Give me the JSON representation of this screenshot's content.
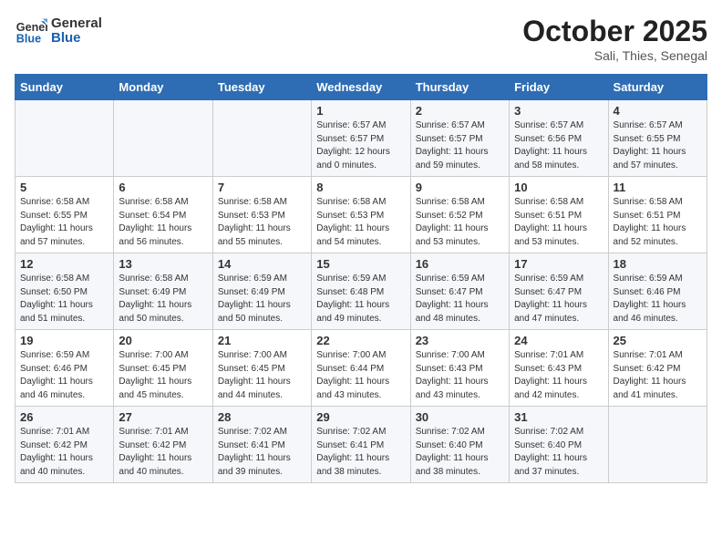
{
  "header": {
    "logo_general": "General",
    "logo_blue": "Blue",
    "month": "October 2025",
    "location": "Sali, Thies, Senegal"
  },
  "days_of_week": [
    "Sunday",
    "Monday",
    "Tuesday",
    "Wednesday",
    "Thursday",
    "Friday",
    "Saturday"
  ],
  "weeks": [
    [
      {
        "day": "",
        "info": ""
      },
      {
        "day": "",
        "info": ""
      },
      {
        "day": "",
        "info": ""
      },
      {
        "day": "1",
        "info": "Sunrise: 6:57 AM\nSunset: 6:57 PM\nDaylight: 12 hours\nand 0 minutes."
      },
      {
        "day": "2",
        "info": "Sunrise: 6:57 AM\nSunset: 6:57 PM\nDaylight: 11 hours\nand 59 minutes."
      },
      {
        "day": "3",
        "info": "Sunrise: 6:57 AM\nSunset: 6:56 PM\nDaylight: 11 hours\nand 58 minutes."
      },
      {
        "day": "4",
        "info": "Sunrise: 6:57 AM\nSunset: 6:55 PM\nDaylight: 11 hours\nand 57 minutes."
      }
    ],
    [
      {
        "day": "5",
        "info": "Sunrise: 6:58 AM\nSunset: 6:55 PM\nDaylight: 11 hours\nand 57 minutes."
      },
      {
        "day": "6",
        "info": "Sunrise: 6:58 AM\nSunset: 6:54 PM\nDaylight: 11 hours\nand 56 minutes."
      },
      {
        "day": "7",
        "info": "Sunrise: 6:58 AM\nSunset: 6:53 PM\nDaylight: 11 hours\nand 55 minutes."
      },
      {
        "day": "8",
        "info": "Sunrise: 6:58 AM\nSunset: 6:53 PM\nDaylight: 11 hours\nand 54 minutes."
      },
      {
        "day": "9",
        "info": "Sunrise: 6:58 AM\nSunset: 6:52 PM\nDaylight: 11 hours\nand 53 minutes."
      },
      {
        "day": "10",
        "info": "Sunrise: 6:58 AM\nSunset: 6:51 PM\nDaylight: 11 hours\nand 53 minutes."
      },
      {
        "day": "11",
        "info": "Sunrise: 6:58 AM\nSunset: 6:51 PM\nDaylight: 11 hours\nand 52 minutes."
      }
    ],
    [
      {
        "day": "12",
        "info": "Sunrise: 6:58 AM\nSunset: 6:50 PM\nDaylight: 11 hours\nand 51 minutes."
      },
      {
        "day": "13",
        "info": "Sunrise: 6:58 AM\nSunset: 6:49 PM\nDaylight: 11 hours\nand 50 minutes."
      },
      {
        "day": "14",
        "info": "Sunrise: 6:59 AM\nSunset: 6:49 PM\nDaylight: 11 hours\nand 50 minutes."
      },
      {
        "day": "15",
        "info": "Sunrise: 6:59 AM\nSunset: 6:48 PM\nDaylight: 11 hours\nand 49 minutes."
      },
      {
        "day": "16",
        "info": "Sunrise: 6:59 AM\nSunset: 6:47 PM\nDaylight: 11 hours\nand 48 minutes."
      },
      {
        "day": "17",
        "info": "Sunrise: 6:59 AM\nSunset: 6:47 PM\nDaylight: 11 hours\nand 47 minutes."
      },
      {
        "day": "18",
        "info": "Sunrise: 6:59 AM\nSunset: 6:46 PM\nDaylight: 11 hours\nand 46 minutes."
      }
    ],
    [
      {
        "day": "19",
        "info": "Sunrise: 6:59 AM\nSunset: 6:46 PM\nDaylight: 11 hours\nand 46 minutes."
      },
      {
        "day": "20",
        "info": "Sunrise: 7:00 AM\nSunset: 6:45 PM\nDaylight: 11 hours\nand 45 minutes."
      },
      {
        "day": "21",
        "info": "Sunrise: 7:00 AM\nSunset: 6:45 PM\nDaylight: 11 hours\nand 44 minutes."
      },
      {
        "day": "22",
        "info": "Sunrise: 7:00 AM\nSunset: 6:44 PM\nDaylight: 11 hours\nand 43 minutes."
      },
      {
        "day": "23",
        "info": "Sunrise: 7:00 AM\nSunset: 6:43 PM\nDaylight: 11 hours\nand 43 minutes."
      },
      {
        "day": "24",
        "info": "Sunrise: 7:01 AM\nSunset: 6:43 PM\nDaylight: 11 hours\nand 42 minutes."
      },
      {
        "day": "25",
        "info": "Sunrise: 7:01 AM\nSunset: 6:42 PM\nDaylight: 11 hours\nand 41 minutes."
      }
    ],
    [
      {
        "day": "26",
        "info": "Sunrise: 7:01 AM\nSunset: 6:42 PM\nDaylight: 11 hours\nand 40 minutes."
      },
      {
        "day": "27",
        "info": "Sunrise: 7:01 AM\nSunset: 6:42 PM\nDaylight: 11 hours\nand 40 minutes."
      },
      {
        "day": "28",
        "info": "Sunrise: 7:02 AM\nSunset: 6:41 PM\nDaylight: 11 hours\nand 39 minutes."
      },
      {
        "day": "29",
        "info": "Sunrise: 7:02 AM\nSunset: 6:41 PM\nDaylight: 11 hours\nand 38 minutes."
      },
      {
        "day": "30",
        "info": "Sunrise: 7:02 AM\nSunset: 6:40 PM\nDaylight: 11 hours\nand 38 minutes."
      },
      {
        "day": "31",
        "info": "Sunrise: 7:02 AM\nSunset: 6:40 PM\nDaylight: 11 hours\nand 37 minutes."
      },
      {
        "day": "",
        "info": ""
      }
    ]
  ]
}
